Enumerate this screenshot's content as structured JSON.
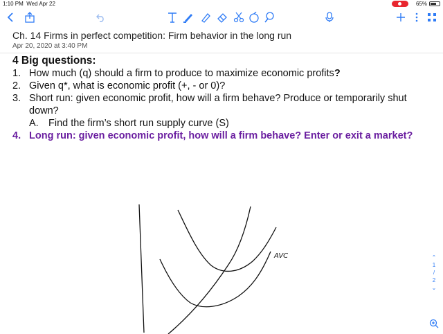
{
  "status_bar": {
    "time": "1:10 PM",
    "date": "Wed Apr 22",
    "battery": "65%"
  },
  "toolbar": {
    "back_icon": "chevron-left-icon",
    "share_icon": "share-icon",
    "undo_icon": "undo-icon",
    "text_tool_icon": "text-tool-icon",
    "pen_icon": "pen-icon",
    "highlighter_icon": "highlighter-icon",
    "eraser_icon": "eraser-icon",
    "scissors_icon": "scissors-icon",
    "shapes_icon": "shapes-icon",
    "lasso_icon": "lasso-icon",
    "mic_icon": "microphone-icon",
    "add_icon": "plus-icon",
    "more_icon": "more-icon",
    "pages_icon": "pages-icon"
  },
  "note": {
    "title": "Ch. 14 Firms in perfect competition: Firm behavior in the long run",
    "date": "Apr 20, 2020 at 3:40 PM"
  },
  "content": {
    "heading": "4 Big questions:",
    "questions": [
      {
        "num": "1.",
        "text": "How much (q) should a firm to produce to maximize economic profits",
        "suffix": "?"
      },
      {
        "num": "2.",
        "text": "Given q*, what is economic profit (+, - or 0)?"
      },
      {
        "num": "3.",
        "text": "Short run: given economic profit, how will a firm behave? Produce or temporarily shut down?"
      },
      {
        "num": "A.",
        "text": "Find the firm’s short run supply curve (S)"
      },
      {
        "num": "4.",
        "text": "Long run: given economic profit, how will a firm behave? Enter or exit a market?"
      }
    ]
  },
  "drawing": {
    "avc_label": "AVC"
  },
  "page_nav": {
    "current": "1",
    "sep": "/",
    "total": "2"
  },
  "colors": {
    "accent": "#2f7cf6",
    "purple": "#6a1ea0",
    "record": "#e8262f"
  }
}
